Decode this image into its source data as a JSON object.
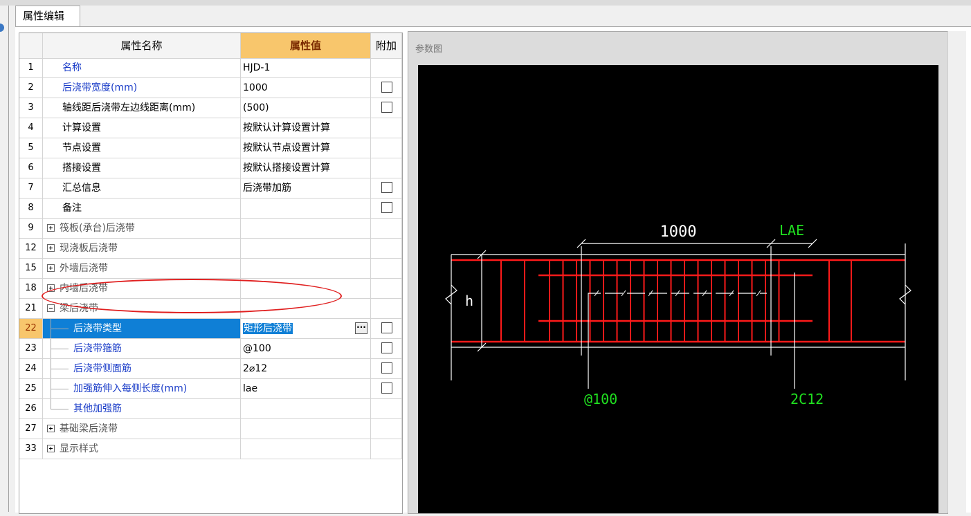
{
  "tab": {
    "title": "属性编辑"
  },
  "grid": {
    "headers": {
      "name": "属性名称",
      "value": "属性值",
      "extra": "附加"
    },
    "rows": [
      {
        "num": "1",
        "name": "名称",
        "value": "HJD-1",
        "style": "blue",
        "checkbox": false,
        "expander": "",
        "indent": 0
      },
      {
        "num": "2",
        "name": "后浇带宽度(mm)",
        "value": "1000",
        "style": "blue",
        "checkbox": true,
        "expander": "",
        "indent": 0
      },
      {
        "num": "3",
        "name": "轴线距后浇带左边线距离(mm)",
        "value": "(500)",
        "style": "",
        "checkbox": true,
        "expander": "",
        "indent": 0
      },
      {
        "num": "4",
        "name": "计算设置",
        "value": "按默认计算设置计算",
        "style": "",
        "checkbox": false,
        "expander": "",
        "indent": 0
      },
      {
        "num": "5",
        "name": "节点设置",
        "value": "按默认节点设置计算",
        "style": "",
        "checkbox": false,
        "expander": "",
        "indent": 0
      },
      {
        "num": "6",
        "name": "搭接设置",
        "value": "按默认搭接设置计算",
        "style": "",
        "checkbox": false,
        "expander": "",
        "indent": 0
      },
      {
        "num": "7",
        "name": "汇总信息",
        "value": "后浇带加筋",
        "style": "",
        "checkbox": true,
        "expander": "",
        "indent": 0
      },
      {
        "num": "8",
        "name": "备注",
        "value": "",
        "style": "",
        "checkbox": true,
        "expander": "",
        "indent": 0
      },
      {
        "num": "9",
        "name": "筏板(承台)后浇带",
        "value": "",
        "style": "gray",
        "checkbox": false,
        "expander": "+",
        "indent": 0
      },
      {
        "num": "12",
        "name": "现浇板后浇带",
        "value": "",
        "style": "gray",
        "checkbox": false,
        "expander": "+",
        "indent": 0
      },
      {
        "num": "15",
        "name": "外墙后浇带",
        "value": "",
        "style": "gray",
        "checkbox": false,
        "expander": "+",
        "indent": 0
      },
      {
        "num": "18",
        "name": "内墙后浇带",
        "value": "",
        "style": "gray",
        "checkbox": false,
        "expander": "+",
        "indent": 0
      },
      {
        "num": "21",
        "name": "梁后浇带",
        "value": "",
        "style": "gray",
        "checkbox": false,
        "expander": "-",
        "indent": 0
      },
      {
        "num": "22",
        "name": "后浇带类型",
        "value": "矩形后浇带",
        "style": "sel",
        "checkbox": true,
        "expander": "",
        "indent": 1,
        "ellipsis": "···"
      },
      {
        "num": "23",
        "name": "后浇带箍筋",
        "value": "@100",
        "style": "blue",
        "checkbox": true,
        "expander": "",
        "indent": 1
      },
      {
        "num": "24",
        "name": "后浇带侧面筋",
        "value": "2⌀12",
        "style": "blue",
        "checkbox": true,
        "expander": "",
        "indent": 1
      },
      {
        "num": "25",
        "name": "加强筋伸入每侧长度(mm)",
        "value": "lae",
        "style": "blue",
        "checkbox": true,
        "expander": "",
        "indent": 1
      },
      {
        "num": "26",
        "name": "其他加强筋",
        "value": "",
        "style": "blue",
        "checkbox": false,
        "expander": "",
        "indent": 1,
        "last": true
      },
      {
        "num": "27",
        "name": "基础梁后浇带",
        "value": "",
        "style": "gray",
        "checkbox": false,
        "expander": "+",
        "indent": 0
      },
      {
        "num": "33",
        "name": "显示样式",
        "value": "",
        "style": "gray",
        "checkbox": false,
        "expander": "+",
        "indent": 0
      }
    ]
  },
  "diagram": {
    "title": "参数图",
    "labels": {
      "width": "1000",
      "lae": "LAE",
      "height": "h",
      "stirrup": "@100",
      "side_bar": "2C12"
    },
    "colors": {
      "bg": "#000000",
      "rebar": "#ff1a1a",
      "line": "#ffffff",
      "text_green": "#20e020"
    }
  }
}
